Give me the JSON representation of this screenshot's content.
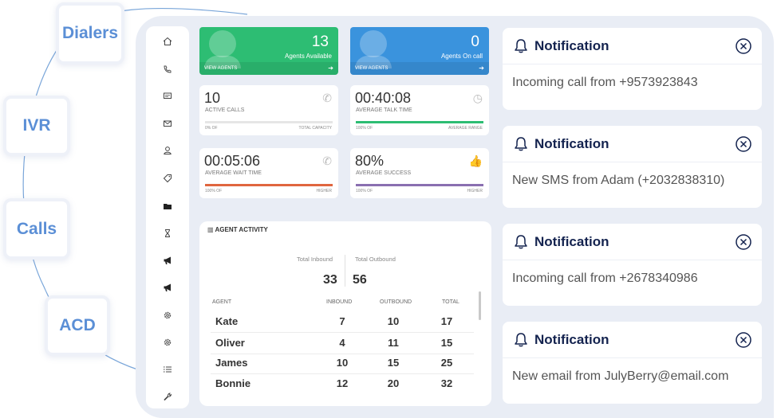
{
  "categories": {
    "dialers": "Dialers",
    "ivr": "IVR",
    "calls": "Calls",
    "acd": "ACD"
  },
  "dashboard": {
    "agents_available": {
      "value": "13",
      "label": "Agents Available",
      "footer": "VIEW AGENTS",
      "color": "#2dbd73"
    },
    "agents_on_call": {
      "value": "0",
      "label": "Agents On call",
      "footer": "VIEW AGENTS",
      "color": "#3a93dd"
    },
    "active_calls": {
      "value": "10",
      "label": "ACTIVE CALLS",
      "foot_left": "0% OF",
      "foot_right": "TOTAL CAPACITY"
    },
    "avg_talk": {
      "value": "00:40:08",
      "label": "AVERAGE TALK TIME",
      "foot_left": "100% OF",
      "foot_right": "AVERAGE RANGE",
      "color": "#2dbd73",
      "fill": 1.0
    },
    "avg_wait": {
      "value": "00:05:06",
      "label": "AVERAGE WAIT TIME",
      "foot_left": "100% OF",
      "foot_right": "HIGHER",
      "color": "#e0663f",
      "fill": 1.0
    },
    "avg_success": {
      "value": "80%",
      "label": "AVERAGE SUCCESS",
      "foot_left": "100% OF",
      "foot_right": "HIGHER",
      "color": "#8a6fb0",
      "fill": 1.0
    }
  },
  "agent_activity": {
    "title": "AGENT ACTIVITY",
    "total_inbound_label": "Total Inbound",
    "total_outbound_label": "Total Outbound",
    "total_inbound": "33",
    "total_outbound": "56",
    "columns": [
      "AGENT",
      "INBOUND",
      "OUTBOUND",
      "TOTAL"
    ],
    "rows": [
      {
        "agent": "Kate",
        "inbound": "7",
        "outbound": "10",
        "total": "17"
      },
      {
        "agent": "Oliver",
        "inbound": "4",
        "outbound": "11",
        "total": "15"
      },
      {
        "agent": "James",
        "inbound": "10",
        "outbound": "15",
        "total": "25"
      },
      {
        "agent": "Bonnie",
        "inbound": "12",
        "outbound": "20",
        "total": "32"
      }
    ]
  },
  "notifications": [
    {
      "title": "Notification",
      "message": "Incoming call from +9573923843"
    },
    {
      "title": "Notification",
      "message": "New SMS from Adam (+2032838310)"
    },
    {
      "title": "Notification",
      "message": "Incoming call from +2678340986"
    },
    {
      "title": "Notification",
      "message": "New email from JulyBerry@email.com"
    }
  ],
  "sidebar_icons": [
    "home-icon",
    "phone-icon",
    "message-icon",
    "mail-icon",
    "user-icon",
    "tag-icon",
    "folder-icon",
    "hourglass-icon",
    "megaphone-icon",
    "megaphone-icon",
    "gear-icon",
    "gear-icon",
    "list-icon",
    "wrench-icon"
  ],
  "colors": {
    "brand_blue": "#5b8fd6",
    "navy": "#14234f"
  }
}
